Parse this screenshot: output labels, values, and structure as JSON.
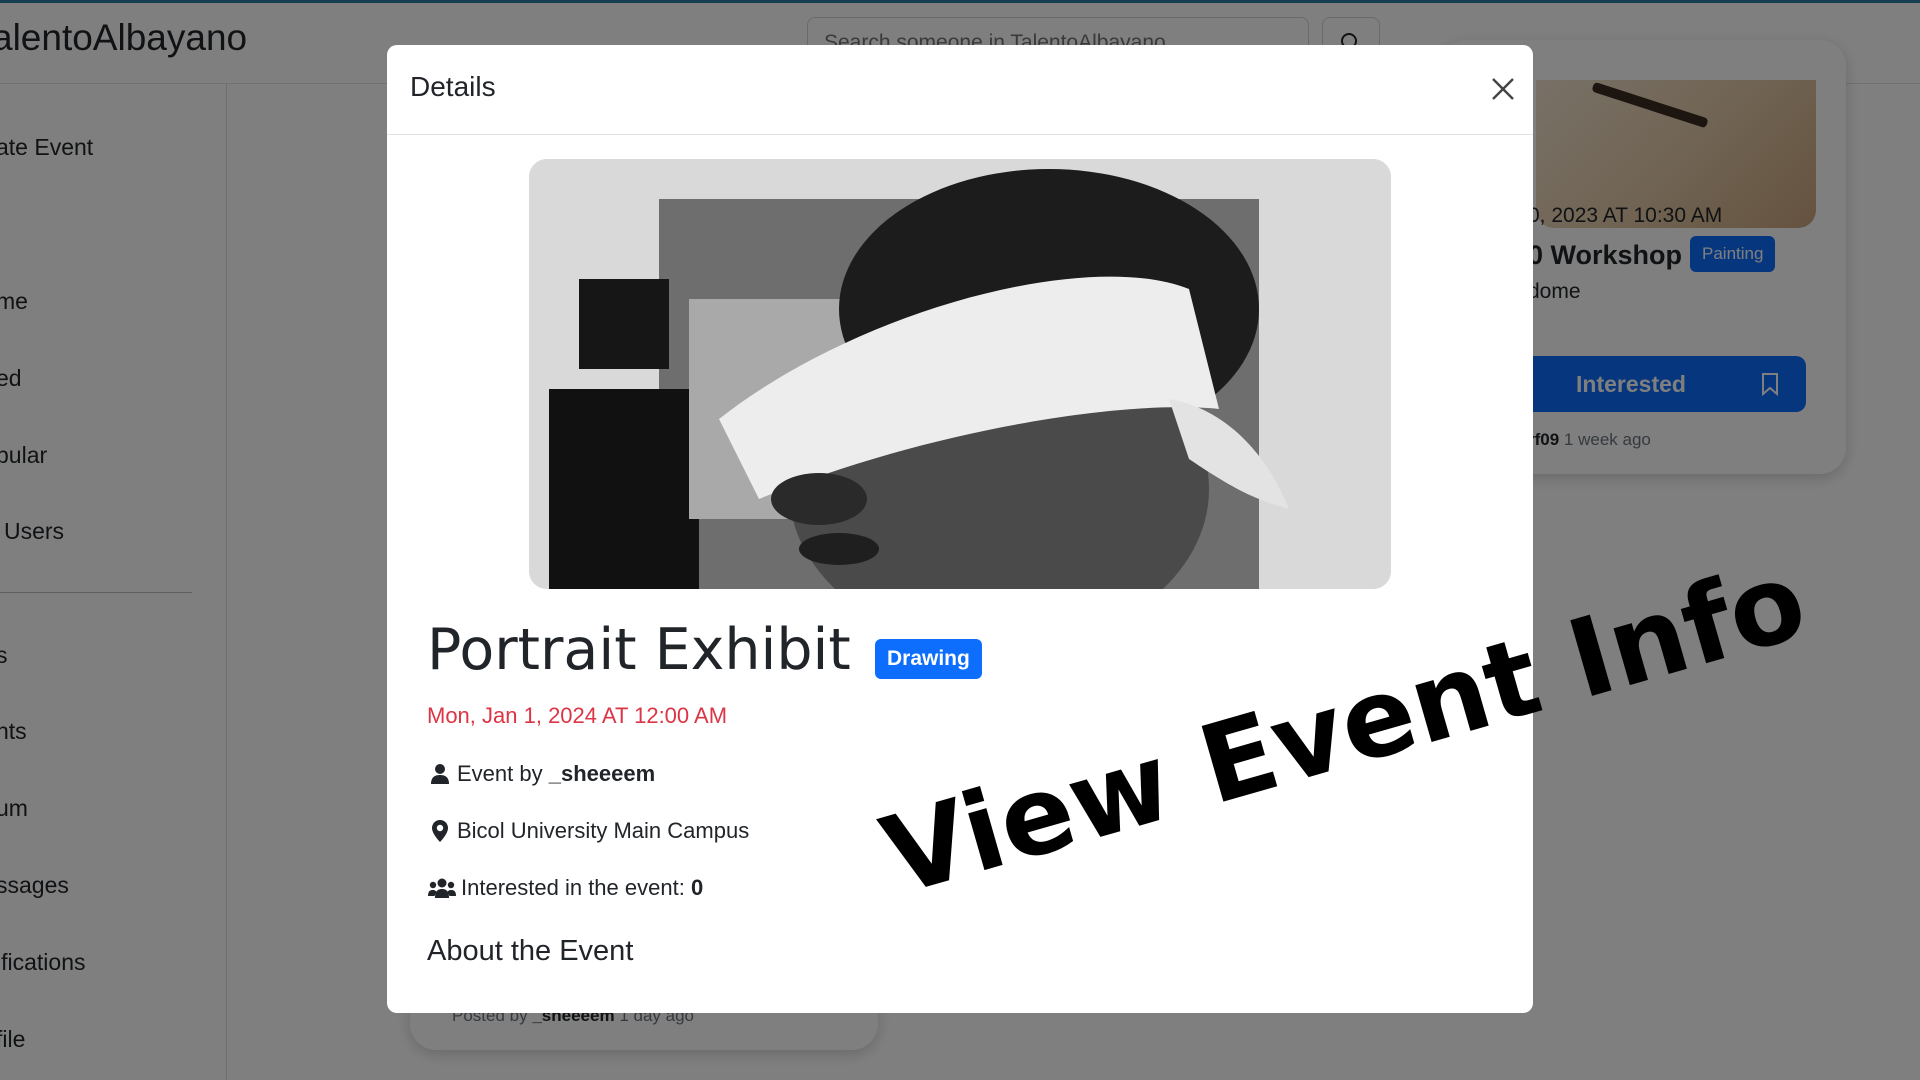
{
  "app": {
    "brand": "alentoAlbayano"
  },
  "search": {
    "placeholder": "Search someone in TalentoAlbayano"
  },
  "sidebar": {
    "items": [
      {
        "label": "ate Event"
      },
      {
        "label": "me"
      },
      {
        "label": "ed"
      },
      {
        "label": "pular"
      },
      {
        "label": "Users"
      },
      {
        "label": "s"
      },
      {
        "label": "nts"
      },
      {
        "label": "um"
      },
      {
        "label": "ssages"
      },
      {
        "label": "ifications"
      },
      {
        "label": "file"
      }
    ]
  },
  "background_cards": {
    "right": {
      "date": "0, 2023 AT 10:30 AM",
      "title": "0 Workshop",
      "badge": "Painting",
      "location": "dome",
      "interested_label": "Interested",
      "posted_user": "rf09",
      "posted_ago": "1 week ago"
    },
    "left": {
      "posted_prefix": "Posted by",
      "posted_user": "_sheeeem",
      "posted_ago": "1 day ago"
    }
  },
  "modal": {
    "title": "Details",
    "event": {
      "title": "Portrait Exhibit",
      "category": "Drawing",
      "date": "Mon, Jan 1, 2024 AT 12:00 AM",
      "by_prefix": "Event by",
      "by_user": "_sheeeem",
      "location": "Bicol University Main Campus",
      "interested_prefix": "Interested in the event:",
      "interested_count": "0",
      "about_heading": "About the Event"
    }
  },
  "overlay": {
    "caption": "View Event Info"
  },
  "colors": {
    "primary": "#0d6efd",
    "date_red": "#dc3545",
    "backdrop": "rgba(0,0,0,0.5)"
  },
  "icons": [
    "search-icon",
    "close-icon",
    "user-icon",
    "map-pin-icon",
    "users-icon",
    "bookmark-icon"
  ]
}
